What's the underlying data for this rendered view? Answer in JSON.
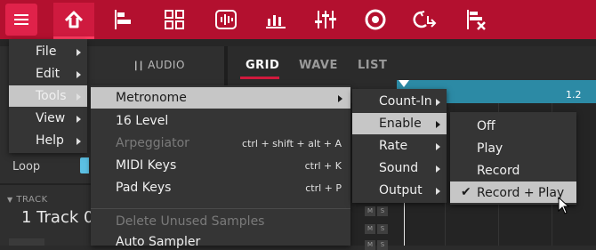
{
  "topbar": {
    "icons": [
      "menu-icon",
      "home-icon",
      "align-left-icon",
      "grid-icon",
      "waveform-icon",
      "bars-icon",
      "mixer-icon",
      "record-icon",
      "loop-icon",
      "delete-row-icon"
    ]
  },
  "left_panel": {
    "audio_label": "AUDIO",
    "loop_label": "Loop",
    "track_header": "TRACK",
    "track_name": "1 Track 0"
  },
  "tabs": [
    {
      "label": "GRID",
      "active": true
    },
    {
      "label": "WAVE",
      "active": false
    },
    {
      "label": "LIST",
      "active": false
    }
  ],
  "ruler": {
    "label": "1.2"
  },
  "mute_solo": {
    "m": "M",
    "s": "S"
  },
  "main_menu": {
    "items": [
      {
        "label": "File",
        "has_submenu": true
      },
      {
        "label": "Edit",
        "has_submenu": true
      },
      {
        "label": "Tools",
        "has_submenu": true,
        "highlighted": true
      },
      {
        "label": "View",
        "has_submenu": true
      },
      {
        "label": "Help",
        "has_submenu": true
      }
    ]
  },
  "tools_menu": {
    "items": [
      {
        "label": "Metronome",
        "has_submenu": true,
        "highlighted": true,
        "shortcut": ""
      },
      {
        "label": "16 Level",
        "shortcut": ""
      },
      {
        "label": "Arpeggiator",
        "disabled": true,
        "shortcut": "ctrl + shift + alt + A"
      },
      {
        "label": "MIDI Keys",
        "shortcut": "ctrl + K"
      },
      {
        "label": "Pad Keys",
        "shortcut": "ctrl + P"
      },
      {
        "label": "Delete Unused Samples",
        "disabled": true,
        "shortcut": ""
      },
      {
        "label": "Auto Sampler",
        "shortcut": ""
      }
    ]
  },
  "metronome_menu": {
    "items": [
      {
        "label": "Count-In",
        "has_submenu": true
      },
      {
        "label": "Enable",
        "has_submenu": true,
        "highlighted": true
      },
      {
        "label": "Rate",
        "has_submenu": true
      },
      {
        "label": "Sound",
        "has_submenu": true
      },
      {
        "label": "Output",
        "has_submenu": true
      }
    ]
  },
  "enable_menu": {
    "items": [
      {
        "label": "Off",
        "checked": false
      },
      {
        "label": "Play",
        "checked": false
      },
      {
        "label": "Record",
        "checked": false
      },
      {
        "label": "Record + Play",
        "checked": true,
        "highlighted": true
      }
    ],
    "check_glyph": "✔"
  },
  "colors": {
    "topbar": "#b3102f",
    "accent": "#e0224a",
    "ruler": "#2c8aa5",
    "menu_bg": "#353535",
    "highlight": "#c6c6c6"
  }
}
